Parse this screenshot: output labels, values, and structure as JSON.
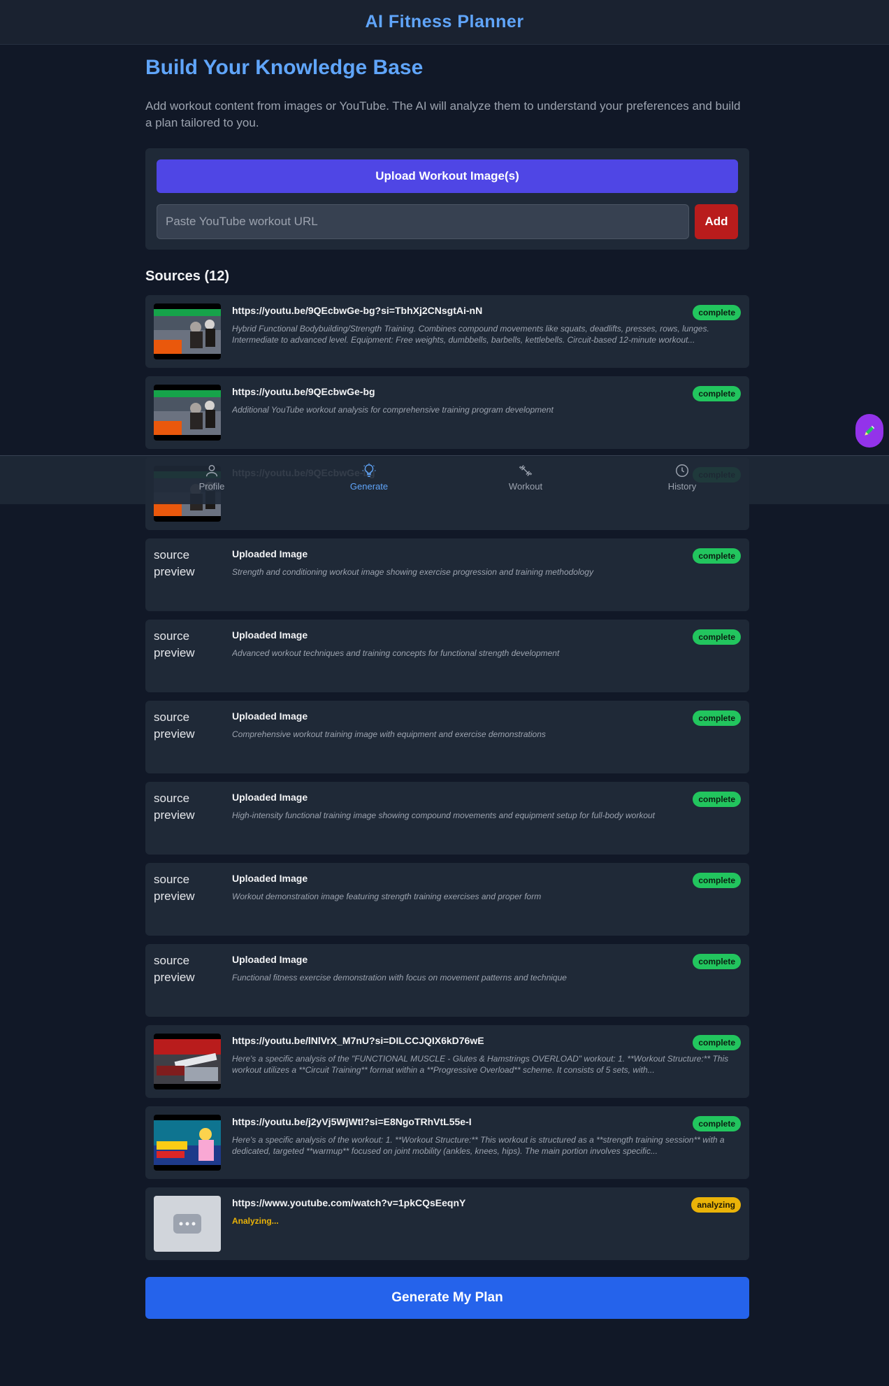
{
  "header": {
    "title": "AI Fitness Planner"
  },
  "page": {
    "title": "Build Your Knowledge Base",
    "intro": "Add workout content from images or YouTube. The AI will analyze them to understand your preferences and build a plan tailored to you."
  },
  "input_panel": {
    "upload_label": "Upload Workout Image(s)",
    "url_placeholder": "Paste YouTube workout URL",
    "url_value": "",
    "add_label": "Add"
  },
  "sources": {
    "heading": "Sources (12)",
    "items": [
      {
        "kind": "youtube",
        "thumb": "thumb-gym",
        "title": "https://youtu.be/9QEcbwGe-bg?si=TbhXj2CNsgtAi-nN",
        "description": "Hybrid Functional Bodybuilding/Strength Training. Combines compound movements like squats, deadlifts, presses, rows, lunges. Intermediate to advanced level. Equipment: Free weights, dumbbells, barbells, kettlebells. Circuit-based 12-minute workout...",
        "status": "complete"
      },
      {
        "kind": "youtube",
        "thumb": "thumb-gym",
        "title": "https://youtu.be/9QEcbwGe-bg",
        "description": "Additional YouTube workout analysis for comprehensive training program development",
        "status": "complete"
      },
      {
        "kind": "youtube",
        "thumb": "thumb-gym",
        "title": "https://youtu.be/9QEcbwGe-bg",
        "description": "",
        "status": "complete"
      },
      {
        "kind": "image",
        "alt": "source preview",
        "title": "Uploaded Image",
        "description": "Strength and conditioning workout image showing exercise progression and training methodology",
        "status": "complete"
      },
      {
        "kind": "image",
        "alt": "source preview",
        "title": "Uploaded Image",
        "description": "Advanced workout techniques and training concepts for functional strength development",
        "status": "complete"
      },
      {
        "kind": "image",
        "alt": "source preview",
        "title": "Uploaded Image",
        "description": "Comprehensive workout training image with equipment and exercise demonstrations",
        "status": "complete"
      },
      {
        "kind": "image",
        "alt": "source preview",
        "title": "Uploaded Image",
        "description": "High-intensity functional training image showing compound movements and equipment setup for full-body workout",
        "status": "complete"
      },
      {
        "kind": "image",
        "alt": "source preview",
        "title": "Uploaded Image",
        "description": "Workout demonstration image featuring strength training exercises and proper form",
        "status": "complete"
      },
      {
        "kind": "image",
        "alt": "source preview",
        "title": "Uploaded Image",
        "description": "Functional fitness exercise demonstration with focus on movement patterns and technique",
        "status": "complete"
      },
      {
        "kind": "youtube",
        "thumb": "thumb-glutes",
        "title": "https://youtu.be/lNlVrX_M7nU?si=DILCCJQIX6kD76wE",
        "description": "Here's a specific analysis of the \"FUNCTIONAL MUSCLE - Glutes & Hamstrings OVERLOAD\" workout: 1. **Workout Structure:** This workout utilizes a **Circuit Training** format within a **Progressive Overload** scheme. It consists of 5 sets, with...",
        "status": "complete"
      },
      {
        "kind": "youtube",
        "thumb": "thumb-fullbody",
        "title": "https://youtu.be/j2yVj5WjWtI?si=E8NgoTRhVtL55e-I",
        "description": "Here's a specific analysis of the workout: 1. **Workout Structure:** This workout is structured as a **strength training session** with a dedicated, targeted **warmup** focused on joint mobility (ankles, knees, hips). The main portion involves specific...",
        "status": "complete"
      },
      {
        "kind": "pending",
        "thumb": "thumb-loading",
        "title": "https://www.youtube.com/watch?v=1pkCQsEeqnY",
        "description": "Analyzing...",
        "status": "analyzing"
      }
    ]
  },
  "generate": {
    "label": "Generate My Plan"
  },
  "bottom_nav": {
    "items": [
      {
        "label": "Profile",
        "icon": "user-icon",
        "active": false
      },
      {
        "label": "Generate",
        "icon": "lightbulb-icon",
        "active": true
      },
      {
        "label": "Workout",
        "icon": "dumbbell-icon",
        "active": false
      },
      {
        "label": "History",
        "icon": "clock-icon",
        "active": false
      }
    ]
  },
  "fab": {
    "icon": "pencil-icon"
  },
  "colors": {
    "background": "#111827",
    "card": "#1f2937",
    "accent": "#60a5fa",
    "upload": "#4f46e5",
    "add": "#b91c1c",
    "generate": "#2563eb",
    "complete": "#22c55e",
    "analyzing": "#eab308",
    "fab": "#9333ea"
  }
}
